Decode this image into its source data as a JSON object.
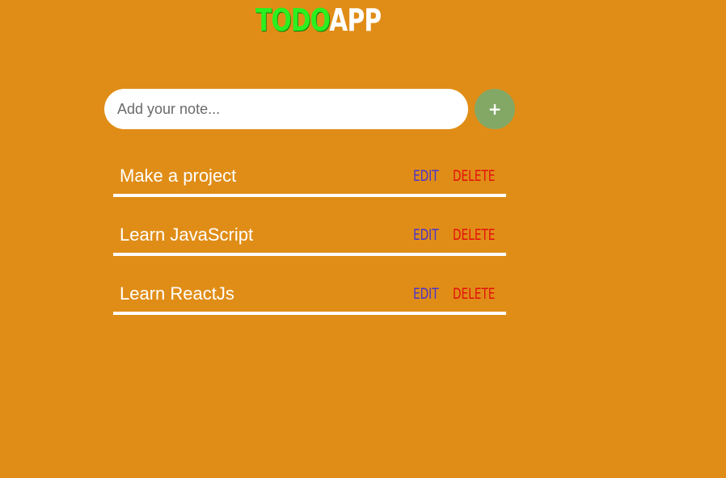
{
  "header": {
    "title_part1": "TODO",
    "title_part2": "APP"
  },
  "note_input": {
    "placeholder": "Add your note...",
    "value": ""
  },
  "add_button": {
    "label": "+"
  },
  "todos": [
    {
      "text": "Make a project",
      "edit_label": "EDIT",
      "delete_label": "DELETE"
    },
    {
      "text": "Learn JavaScript",
      "edit_label": "EDIT",
      "delete_label": "DELETE"
    },
    {
      "text": "Learn ReactJs",
      "edit_label": "EDIT",
      "delete_label": "DELETE"
    }
  ],
  "colors": {
    "background": "#e08d17",
    "title_accent": "#2bef1f",
    "add_button": "#83a866",
    "edit": "#4b34c9",
    "delete": "#e3100b"
  }
}
